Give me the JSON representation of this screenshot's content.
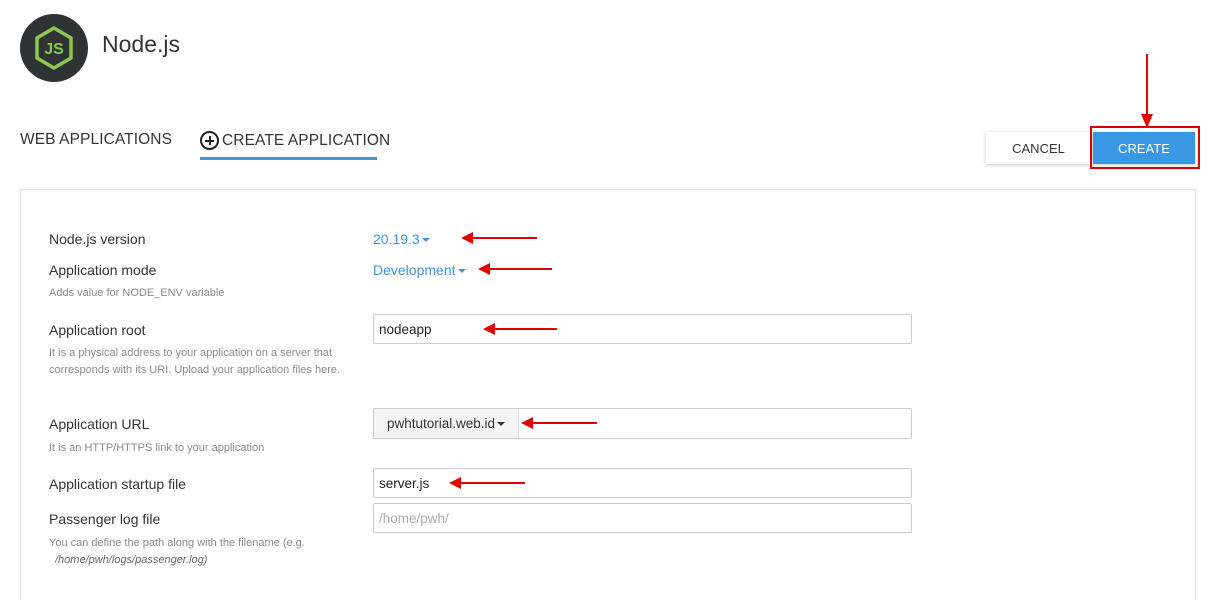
{
  "header": {
    "app_title": "Node.js",
    "logo_icon": "nodejs-logo-icon"
  },
  "tabs": [
    {
      "label": "WEB APPLICATIONS",
      "active": false
    },
    {
      "label": "CREATE APPLICATION",
      "active": true,
      "icon": "plus-circle-icon"
    }
  ],
  "actions": {
    "cancel_label": "CANCEL",
    "create_label": "CREATE"
  },
  "form": {
    "node_version": {
      "label": "Node.js version",
      "value": "20.19.3"
    },
    "app_mode": {
      "label": "Application mode",
      "value": "Development",
      "hint": "Adds value for NODE_ENV variable"
    },
    "app_root": {
      "label": "Application root",
      "value": "nodeapp",
      "hint": "It is a physical address to your application on a server that corresponds with its URI. Upload your application files here."
    },
    "app_url": {
      "label": "Application URL",
      "domain": "pwhtutorial.web.id",
      "path": "",
      "hint": "It is an HTTP/HTTPS link to your application"
    },
    "startup_file": {
      "label": "Application startup file",
      "value": "server.js"
    },
    "log_file": {
      "label": "Passenger log file",
      "value": "",
      "placeholder": "/home/pwh/",
      "hint": "You can define the path along with the filename (e.g.",
      "hint_example": "/home/pwh/logs/passenger.log)"
    }
  },
  "colors": {
    "accent": "#3a97e3",
    "annotation": "#e00000",
    "logo_bg": "#2f3336",
    "logo_green": "#8cc84b"
  }
}
